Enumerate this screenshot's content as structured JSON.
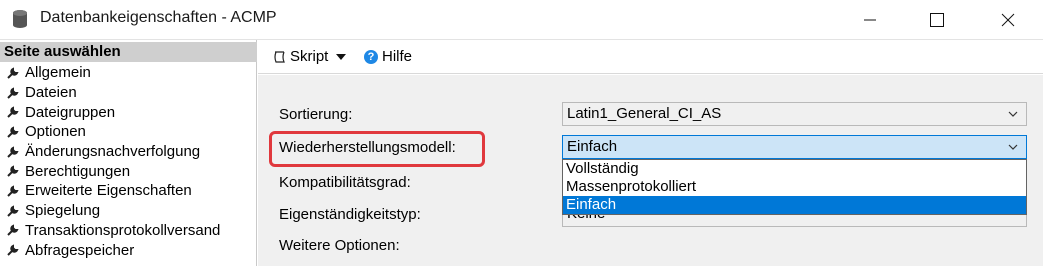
{
  "window": {
    "title": "Datenbankeigenschaften - ACMP"
  },
  "sidebar": {
    "header": "Seite auswählen",
    "items": [
      {
        "label": "Allgemein"
      },
      {
        "label": "Dateien"
      },
      {
        "label": "Dateigruppen"
      },
      {
        "label": "Optionen"
      },
      {
        "label": "Änderungsnachverfolgung"
      },
      {
        "label": "Berechtigungen"
      },
      {
        "label": "Erweiterte Eigenschaften"
      },
      {
        "label": "Spiegelung"
      },
      {
        "label": "Transaktionsprotokollversand"
      },
      {
        "label": "Abfragespeicher"
      }
    ]
  },
  "toolbar": {
    "script_label": "Skript",
    "help_label": "Hilfe"
  },
  "form": {
    "sort_label": "Sortierung:",
    "sort_value": "Latin1_General_CI_AS",
    "recovery_label": "Wiederherstellungsmodell:",
    "recovery_value": "Einfach",
    "recovery_options": [
      "Vollständig",
      "Massenprotokolliert",
      "Einfach"
    ],
    "compat_label": "Kompatibilitätsgrad:",
    "containment_label": "Eigenständigkeitstyp:",
    "containment_value": "Keine",
    "more_options_label": "Weitere Optionen:"
  },
  "colors": {
    "highlight": "#e0383d",
    "selection": "#0078d7"
  }
}
